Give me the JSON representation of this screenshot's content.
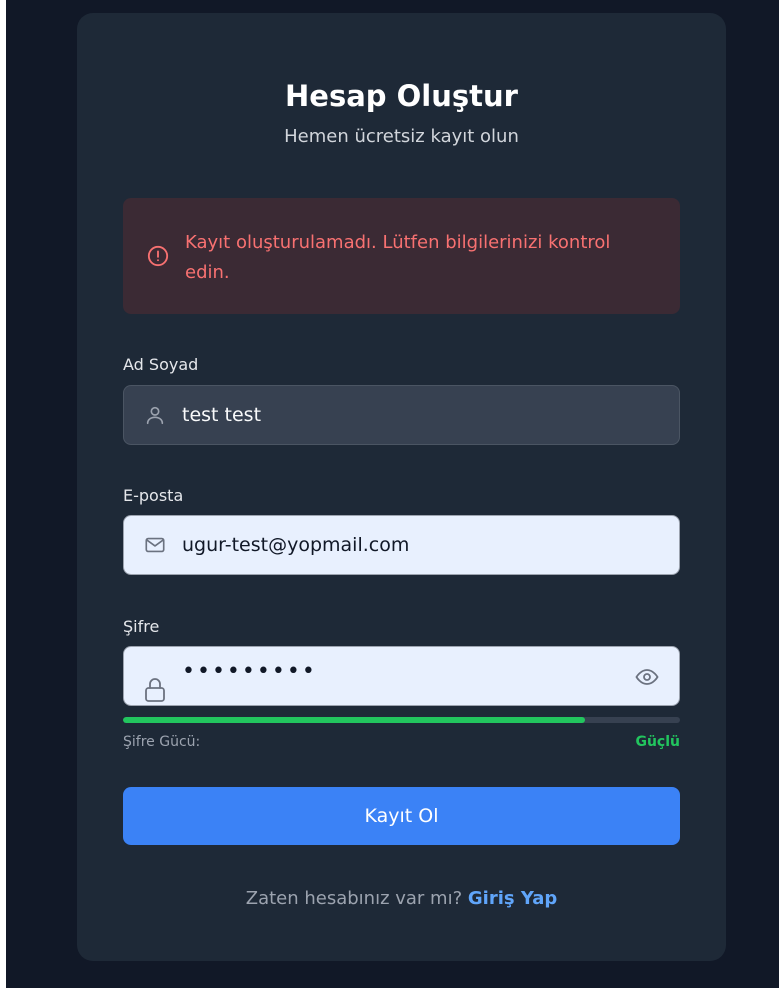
{
  "header": {
    "title": "Hesap Oluştur",
    "subtitle": "Hemen ücretsiz kayıt olun"
  },
  "alert": {
    "message": "Kayıt oluşturulamadı. Lütfen bilgilerinizi kontrol edin.",
    "icon": "alert-circle-icon",
    "color": "#f87171"
  },
  "form": {
    "name": {
      "label": "Ad Soyad",
      "value": "test test",
      "icon": "user-icon"
    },
    "email": {
      "label": "E-posta",
      "value": "ugur-test@yopmail.com",
      "icon": "mail-icon"
    },
    "password": {
      "label": "Şifre",
      "masked_value": "•••••••••",
      "icon": "lock-icon",
      "toggle_icon": "eye-icon"
    },
    "strength": {
      "label": "Şifre Gücü:",
      "value": "Güçlü",
      "level": 0.83,
      "color": "#22c55e"
    },
    "submit_label": "Kayıt Ol"
  },
  "footer": {
    "prompt": "Zaten hesabınız var mı?",
    "link_label": "Giriş Yap"
  },
  "colors": {
    "accent": "#3b82f6",
    "background": "#111827",
    "card": "#1e2937"
  }
}
